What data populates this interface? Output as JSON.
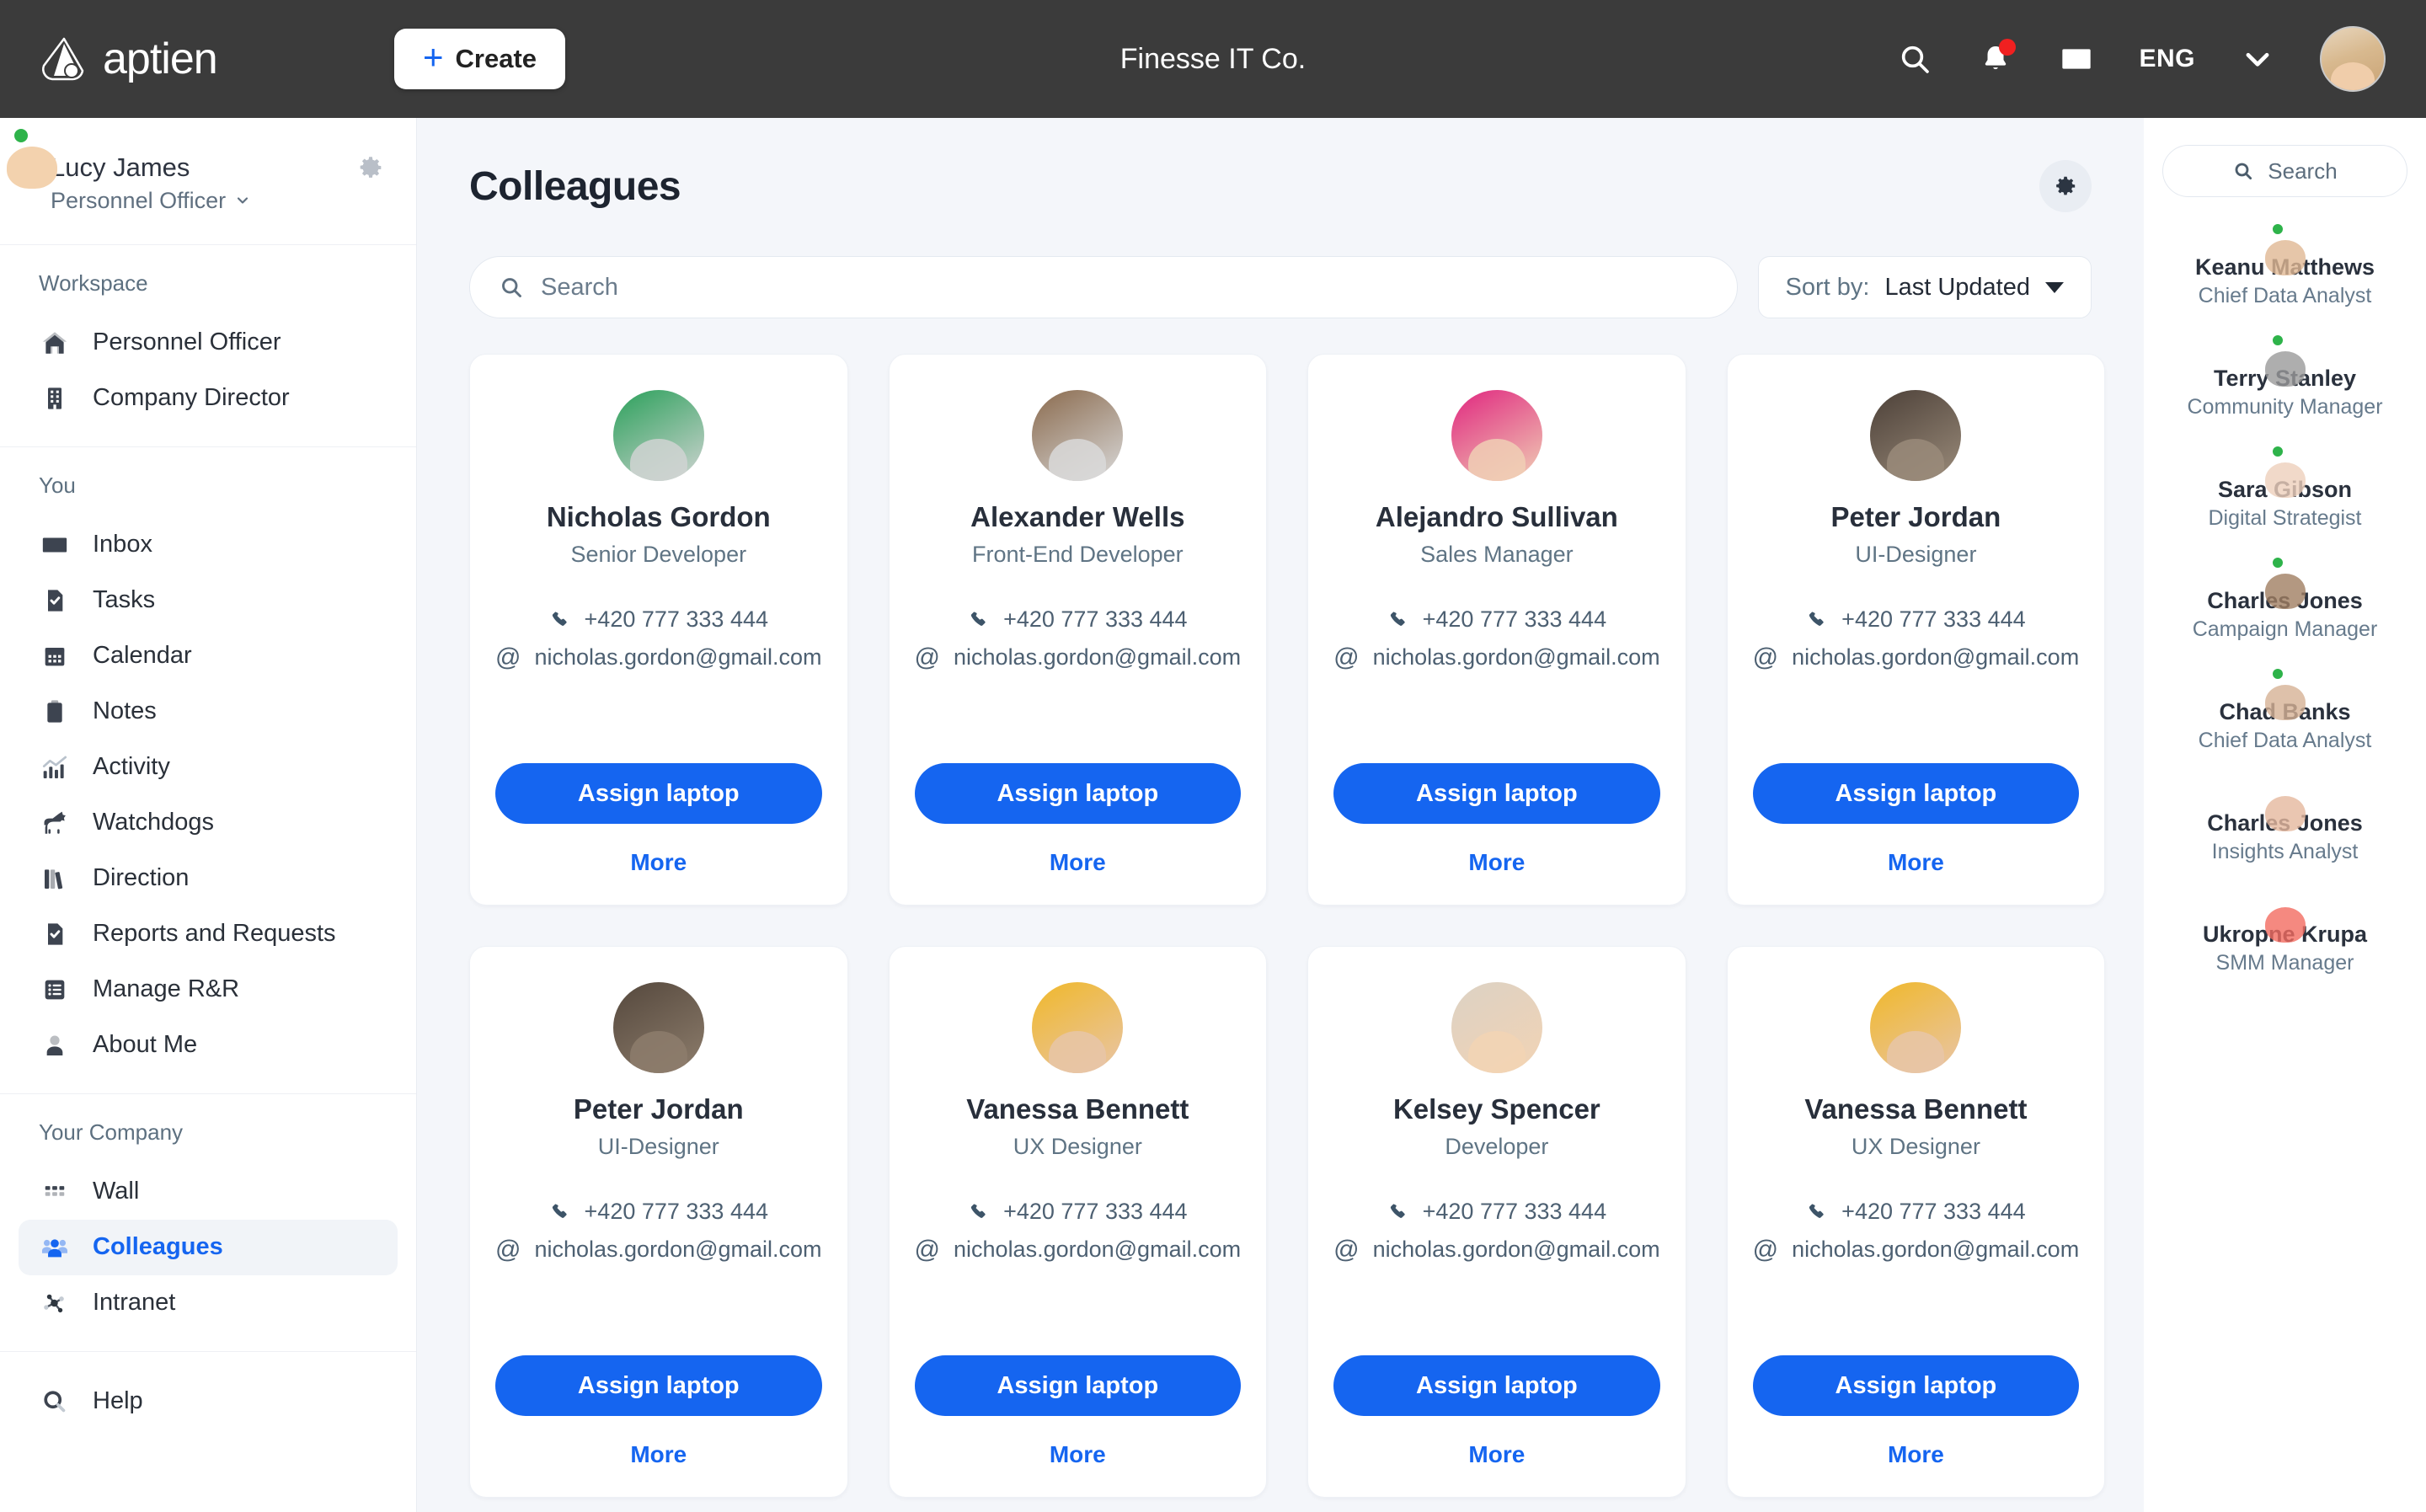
{
  "topbar": {
    "logo_text": "aptien",
    "create_label": "Create",
    "company_title": "Finesse IT Co.",
    "language": "ENG",
    "icons": [
      "search-icon",
      "bell-icon",
      "mail-icon",
      "chevron-down-icon"
    ],
    "has_notification": true,
    "background": "#3b3b3b",
    "accent": "#1565f0"
  },
  "sidebar": {
    "user": {
      "name": "Lucy James",
      "role": "Personnel Officer",
      "online": true
    },
    "sections": [
      {
        "title": "Workspace",
        "items": [
          {
            "label": "Personnel Officer",
            "icon": "home-icon",
            "active": false
          },
          {
            "label": "Company Director",
            "icon": "building-icon",
            "active": false
          }
        ]
      },
      {
        "title": "You",
        "items": [
          {
            "label": "Inbox",
            "icon": "mail-icon",
            "active": false
          },
          {
            "label": "Tasks",
            "icon": "task-check-icon",
            "active": false
          },
          {
            "label": "Calendar",
            "icon": "calendar-icon",
            "active": false
          },
          {
            "label": "Notes",
            "icon": "clipboard-icon",
            "active": false
          },
          {
            "label": "Activity",
            "icon": "bar-chart-icon",
            "active": false
          },
          {
            "label": "Watchdogs",
            "icon": "dog-icon",
            "active": false
          },
          {
            "label": "Direction",
            "icon": "books-icon",
            "active": false
          },
          {
            "label": "Reports and Requests",
            "icon": "report-check-icon",
            "active": false
          },
          {
            "label": "Manage R&R",
            "icon": "list-icon",
            "active": false
          },
          {
            "label": "About Me",
            "icon": "person-icon",
            "active": false
          }
        ]
      },
      {
        "title": "Your Company",
        "items": [
          {
            "label": "Wall",
            "icon": "grid-dots-icon",
            "active": false
          },
          {
            "label": "Colleagues",
            "icon": "people-icon",
            "active": true
          },
          {
            "label": "Intranet",
            "icon": "network-icon",
            "active": false
          }
        ]
      },
      {
        "title": "",
        "items": [
          {
            "label": "Help",
            "icon": "search-help-icon",
            "active": false
          }
        ]
      }
    ]
  },
  "main": {
    "page_title": "Colleagues",
    "settings_icon": "gear-icon",
    "search_placeholder": "Search",
    "sort": {
      "label": "Sort by:",
      "value": "Last Updated"
    },
    "cards": [
      {
        "name": "Nicholas Gordon",
        "role": "Senior Developer",
        "phone": "+420 777 333 444",
        "email": "nicholas.gordon@gmail.com",
        "action": "Assign laptop",
        "more": "More",
        "av1": "#2aa05a",
        "av2": "#d0d4d2"
      },
      {
        "name": "Alexander Wells",
        "role": "Front-End Developer",
        "phone": "+420 777 333 444",
        "email": "nicholas.gordon@gmail.com",
        "action": "Assign laptop",
        "more": "More",
        "av1": "#8a6a4d",
        "av2": "#d9d9d9"
      },
      {
        "name": "Alejandro Sullivan",
        "role": "Sales Manager",
        "phone": "+420 777 333 444",
        "email": "nicholas.gordon@gmail.com",
        "action": "Assign laptop",
        "more": "More",
        "av1": "#e0267f",
        "av2": "#f0cfb5"
      },
      {
        "name": "Peter Jordan",
        "role": "UI-Designer",
        "phone": "+420 777 333 444",
        "email": "nicholas.gordon@gmail.com",
        "action": "Assign laptop",
        "more": "More",
        "av1": "#4c4038",
        "av2": "#9a8b7a"
      },
      {
        "name": "Peter Jordan",
        "role": "UI-Designer",
        "phone": "+420 777 333 444",
        "email": "nicholas.gordon@gmail.com",
        "action": "Assign laptop",
        "more": "More",
        "av1": "#55483d",
        "av2": "#8d7d6c"
      },
      {
        "name": "Vanessa Bennett",
        "role": "UX Designer",
        "phone": "+420 777 333 444",
        "email": "nicholas.gordon@gmail.com",
        "action": "Assign laptop",
        "more": "More",
        "av1": "#f0b82a",
        "av2": "#e8c5a8"
      },
      {
        "name": "Kelsey Spencer",
        "role": "Developer",
        "phone": "+420 777 333 444",
        "email": "nicholas.gordon@gmail.com",
        "action": "Assign laptop",
        "more": "More",
        "av1": "#dcd2c4",
        "av2": "#f2d3b4"
      },
      {
        "name": "Vanessa Bennett",
        "role": "UX Designer",
        "phone": "+420 777 333 444",
        "email": "nicholas.gordon@gmail.com",
        "action": "Assign laptop",
        "more": "More",
        "av1": "#f0b82a",
        "av2": "#e8c5a8"
      }
    ]
  },
  "right_panel": {
    "search_placeholder": "Search",
    "contacts": [
      {
        "name": "Keanu Matthews",
        "role": "Chief Data Analyst",
        "online": true,
        "av1": "#7d94a6",
        "av2": "#e0b894"
      },
      {
        "name": "Terry Stanley",
        "role": "Community Manager",
        "online": true,
        "av1": "#1a1a1a",
        "av2": "#9a9a9a"
      },
      {
        "name": "Sara Gibson",
        "role": "Digital Strategist",
        "online": true,
        "av1": "#b8a79a",
        "av2": "#edd0bb"
      },
      {
        "name": "Charles Jones",
        "role": "Campaign Manager",
        "online": true,
        "av1": "#211d1c",
        "av2": "#a07e62"
      },
      {
        "name": "Chad Banks",
        "role": "Chief Data Analyst",
        "online": true,
        "av1": "#8e9aa0",
        "av2": "#d6b295"
      },
      {
        "name": "Charles Jones",
        "role": "Insights Analyst",
        "online": false,
        "av1": "#2a1c20",
        "av2": "#e5b89e"
      },
      {
        "name": "Ukropne Krupa",
        "role": "SMM Manager",
        "online": false,
        "av1": "#e8252a",
        "av2": "#f26b60"
      }
    ]
  }
}
